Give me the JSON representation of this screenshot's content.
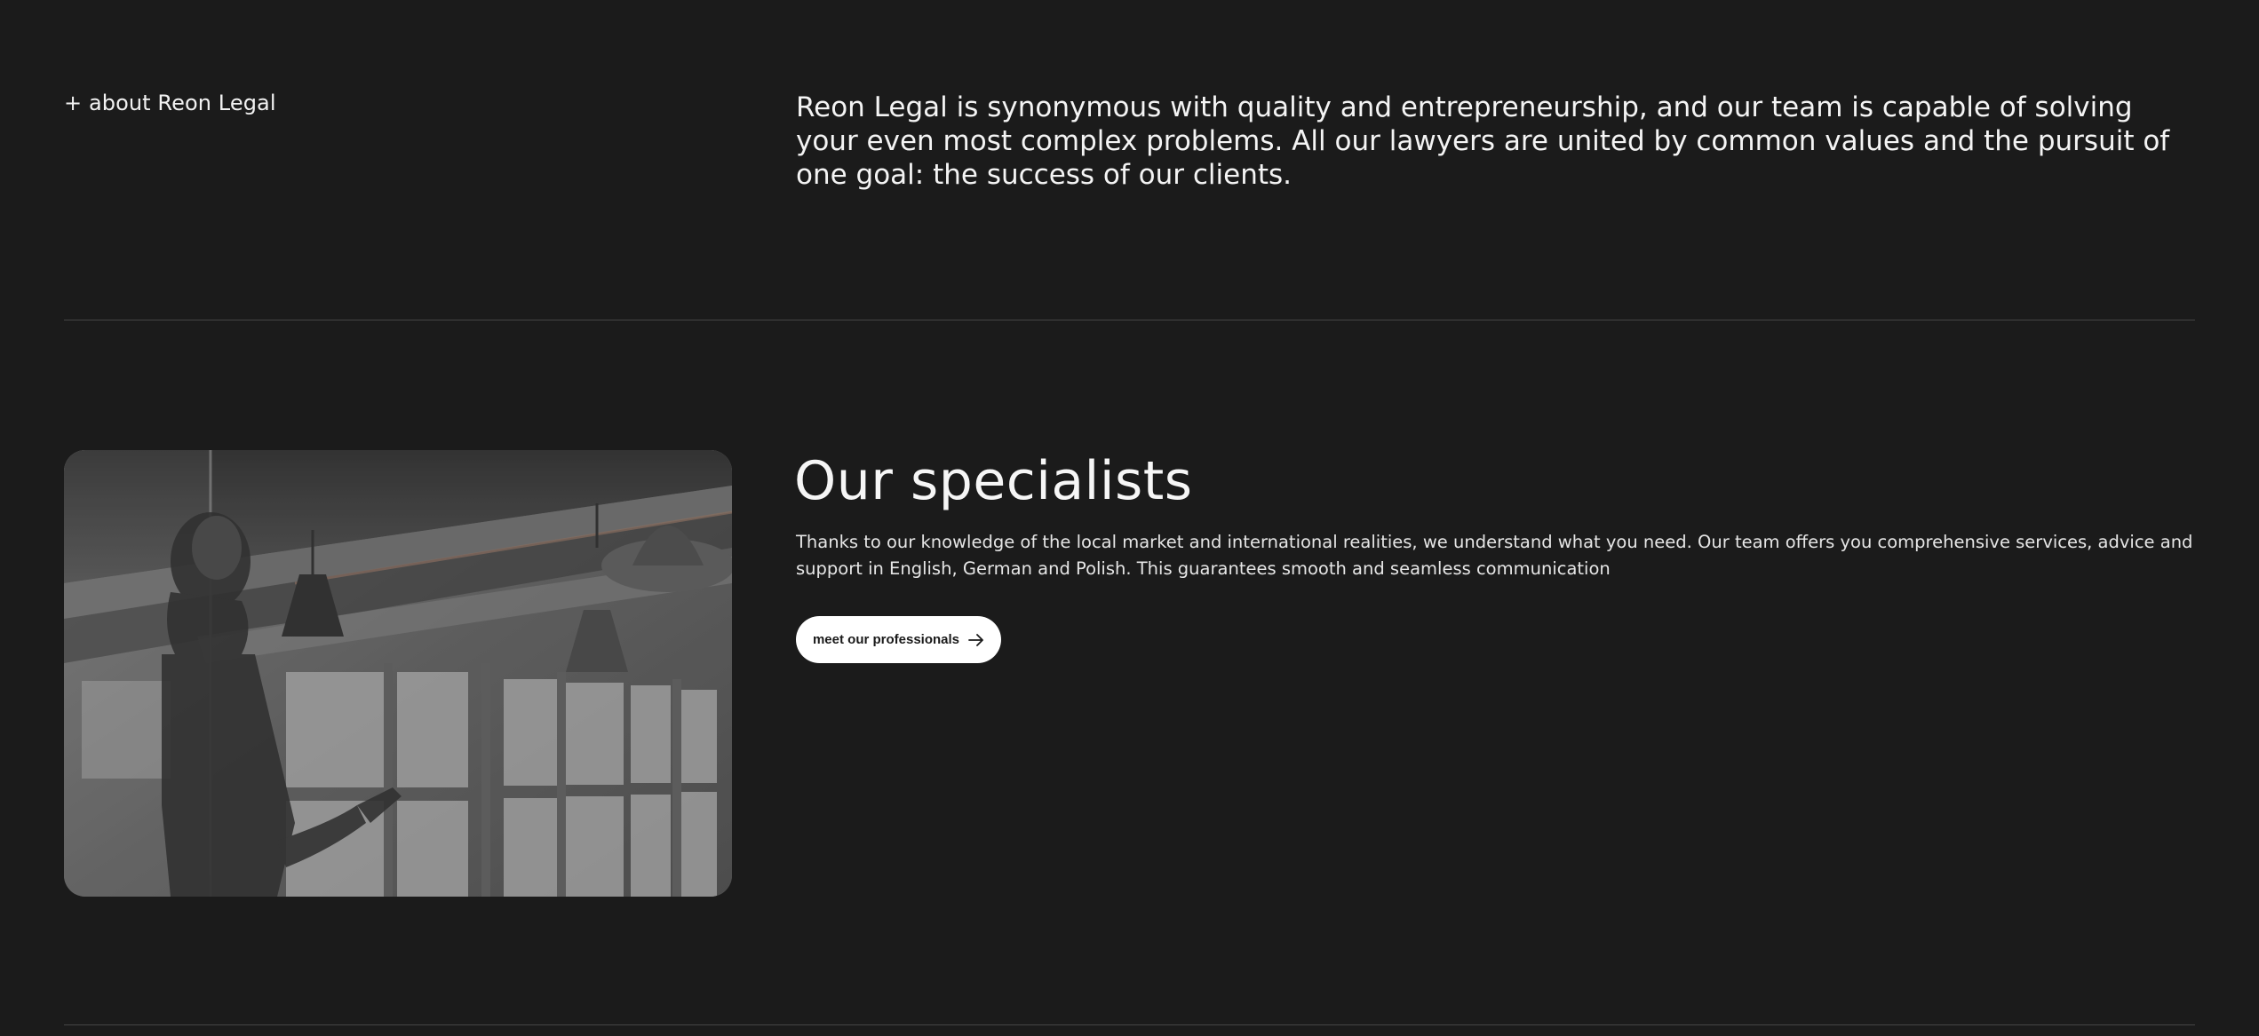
{
  "about": {
    "label": "+ about Reon Legal",
    "text": "Reon Legal is synonymous with quality and entrepreneurship, and our team is capable of solving your even most complex problems. All our lawyers are united by common values and the pursuit of one goal: the success of our clients."
  },
  "specialists": {
    "title": "Our specialists",
    "text": "Thanks to our knowledge of the local market and international realities, we understand what you need. Our team offers you comprehensive services, advice and support in English, German and Polish. This guarantees smooth and seamless communication",
    "button_label": "meet our professionals",
    "button_icon": "arrow-right-icon",
    "image": "office-photo-grayscale"
  },
  "colors": {
    "background": "#1b1b1b",
    "text": "#f4f4f4",
    "divider": "#454545",
    "button_bg": "#ffffff",
    "button_text": "#1a1a1a"
  }
}
